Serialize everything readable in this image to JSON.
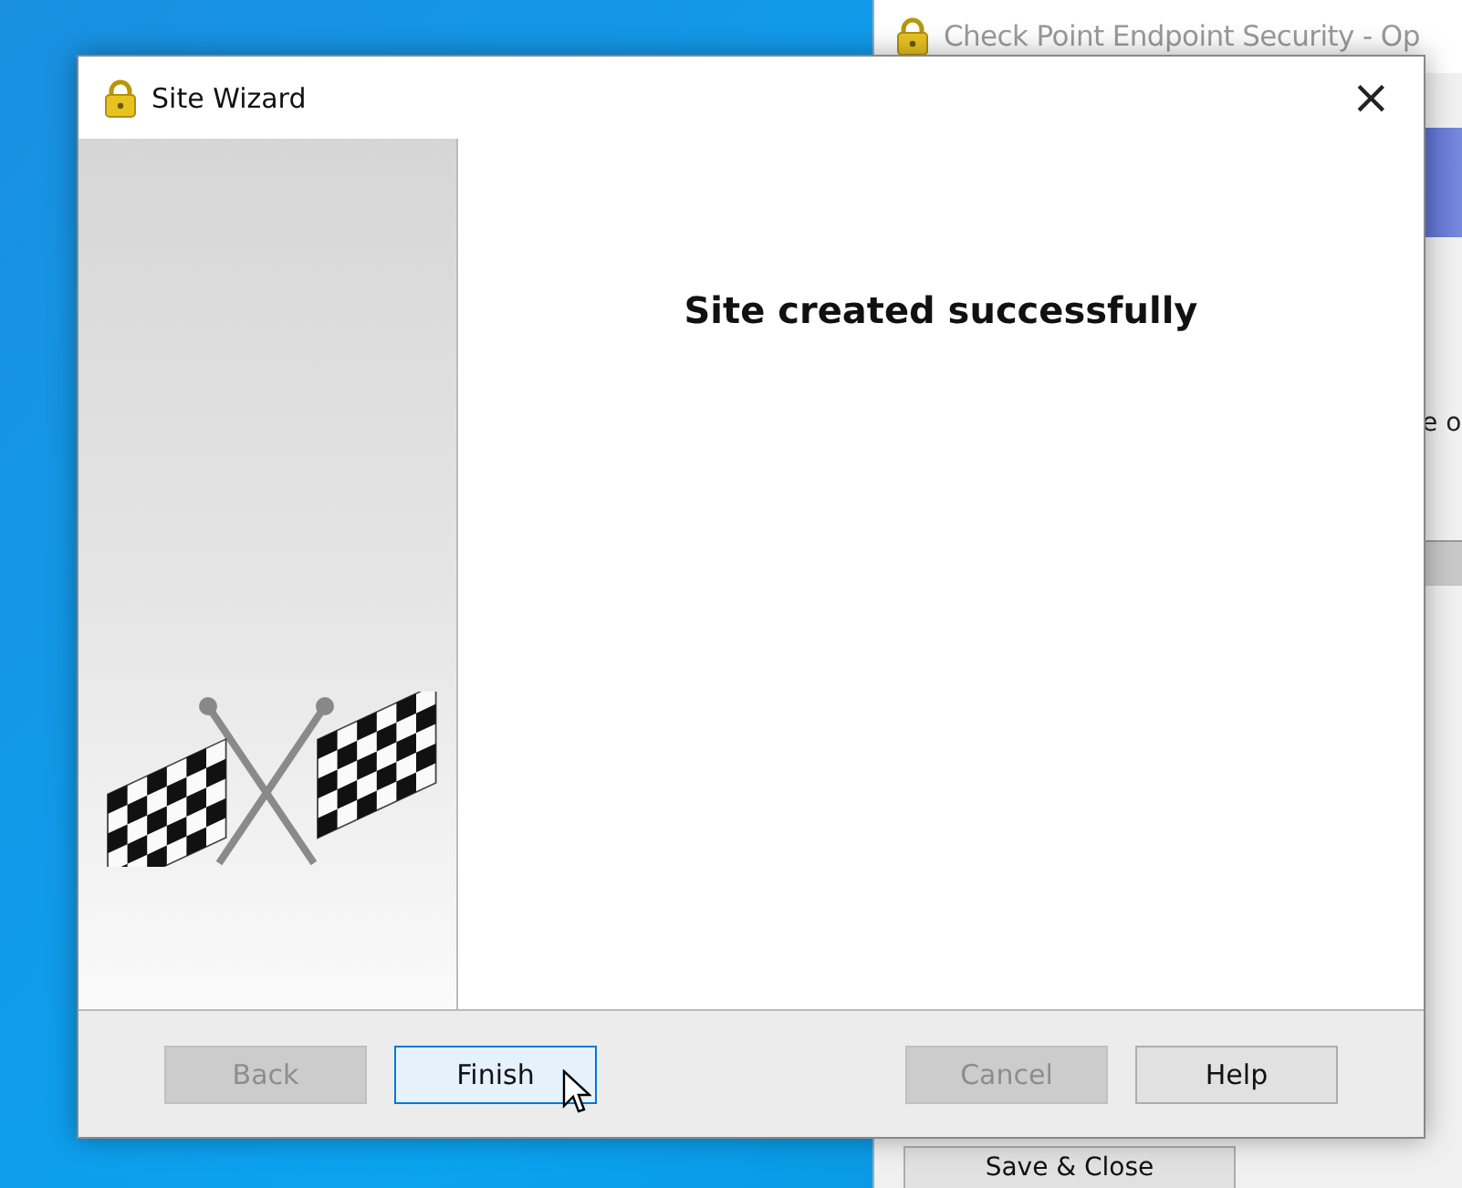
{
  "background_window": {
    "title": "Check Point Endpoint Security - Op",
    "partial_text": "e o",
    "button": "Save & Close"
  },
  "dialog": {
    "title": "Site Wizard",
    "close": "×",
    "heading": "Site created successfully",
    "buttons": [
      {
        "label": "Back",
        "disabled": true,
        "focused": false
      },
      {
        "label": "Finish",
        "disabled": false,
        "focused": true
      },
      {
        "label": "Cancel",
        "disabled": true,
        "focused": false
      },
      {
        "label": "Help",
        "disabled": false,
        "focused": false
      }
    ]
  }
}
